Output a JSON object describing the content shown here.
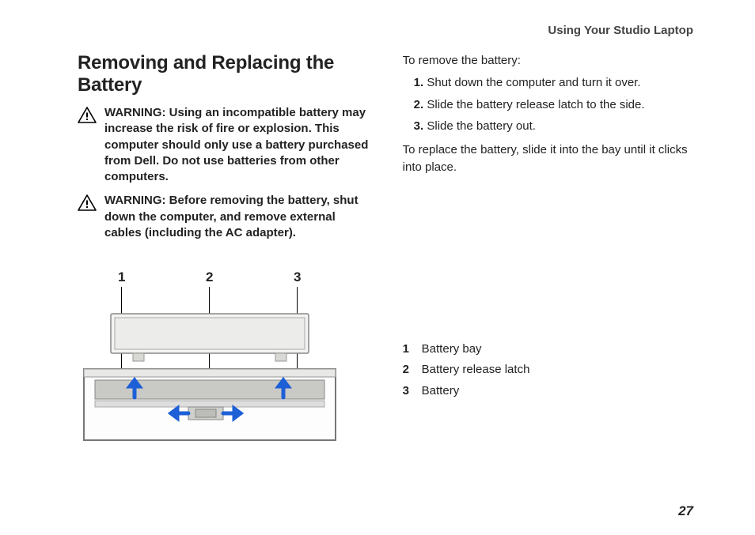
{
  "header": "Using Your Studio Laptop",
  "title": "Removing and Replacing the Battery",
  "warnings": [
    "WARNING: Using an incompatible battery may increase the risk of fire or explosion. This computer should only use a battery purchased from Dell. Do not use batteries from other computers.",
    "WARNING: Before removing the battery, shut down the computer, and remove external cables (including the AC adapter)."
  ],
  "remove_intro": "To remove the battery:",
  "steps": [
    "Shut down the computer and turn it over.",
    "Slide the battery release latch to the side.",
    "Slide the battery out."
  ],
  "replace_text": "To replace the battery, slide it into the bay until it clicks into place.",
  "callouts": [
    "1",
    "2",
    "3"
  ],
  "legend": [
    {
      "num": "1",
      "label": "Battery bay"
    },
    {
      "num": "2",
      "label": "Battery release latch"
    },
    {
      "num": "3",
      "label": "Battery"
    }
  ],
  "page_number": "27"
}
